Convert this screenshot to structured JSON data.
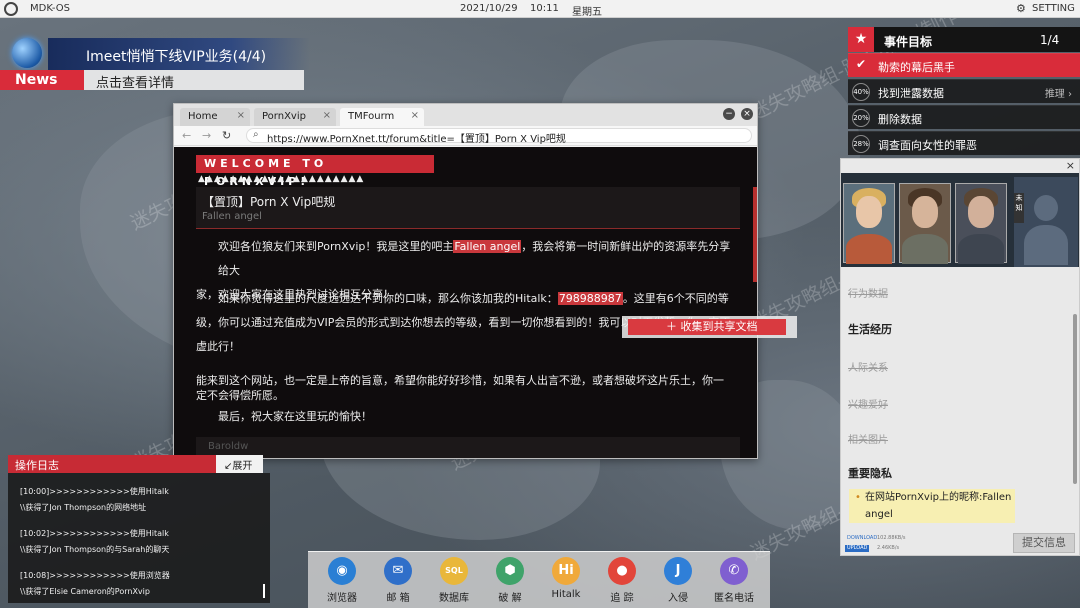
{
  "topbar": {
    "os_name": "MDK-OS",
    "date": "2021/10/29",
    "time": "10:11",
    "weekday": "星期五",
    "setting_label": "SETTING"
  },
  "news": {
    "headline": "Imeet悄悄下线VIP业务(4/4)",
    "tag": "News",
    "link_text": "点击查看详情"
  },
  "browser": {
    "tabs": [
      {
        "label": "Home",
        "active": false
      },
      {
        "label": "PornXvip",
        "active": false
      },
      {
        "label": "TMFourm",
        "active": true
      }
    ],
    "minimize_glyph": "−",
    "close_glyph": "×",
    "url": "https://www.PornXnet.tt/forum&title=【置顶】Porn X Vip吧规",
    "page": {
      "banner": "WELCOME TO PORNXVIP!",
      "decoration": "▲▲▲▲▲▲▲▲▲▲▲▲▲▲▲▲▲▲▲▲▲",
      "post_title": "【置顶】Porn X Vip吧规",
      "post_author": "Fallen angel",
      "p1_a": "欢迎各位狼友们来到PornXvip！我是这里的吧主",
      "p1_hl": "Fallen angel",
      "p1_b": "，我会将第一时间新鲜出炉的资源率先分享给大",
      "p1_c": "家，欢迎大家在这里热烈讨论相互分享！",
      "p2_a": "如果你觉得这里的尺度远远达不到你的口味，那么你该加我的Hitalk：",
      "p2_hl": "798988987",
      "p2_b": "。这里有6个不同的等",
      "p2_c": "级，你可以通过充值成为VIP会员的形式到达你想去的等级，看到一切你想看到的！我可以对天发誓，你一定不",
      "p2_d": "虚此行！",
      "p3_a": "能来到这个网站，也一定是上帝的旨意，希望你能好好珍惜，如果有人出言不逊，或者想破坏这片乐土，你一",
      "p3_b": "定不会得偿所愿。",
      "p4": "最后，祝大家在这里玩的愉快！",
      "footer_user": "Baroldw"
    }
  },
  "context_menu": {
    "item": "＋ 收集到共享文档"
  },
  "events": {
    "title": "事件目标",
    "count": "1/4",
    "items": [
      {
        "status": "done",
        "label": "勒索的幕后黑手",
        "extra": ""
      },
      {
        "status": "40%",
        "label": "找到泄露数据",
        "extra": "推理 ›"
      },
      {
        "status": "20%",
        "label": "删除数据",
        "extra": ""
      },
      {
        "status": "28%",
        "label": "调查面向女性的罪恶",
        "extra": ""
      }
    ]
  },
  "profile": {
    "close": "×",
    "unknown_tag": "未知",
    "section_prev": "行为数据",
    "section_life": "生活经历",
    "item_relations": "人际关系",
    "item_hobbies": "兴趣爱好",
    "item_photos": "相关图片",
    "section_secrets": "重要隐私",
    "secret_text": "在网站PornXvip上的昵称:Fallen angel",
    "download_label": "DOWNLOAD",
    "download_value": "102.88KB/s",
    "upload_label": "UPLOAD",
    "upload_value": "2.46KB/s",
    "submit": "提交信息"
  },
  "log": {
    "title": "操作日志",
    "expand": "↙展开",
    "lines": [
      "[10:00]>>>>>>>>>>>>使用Hitalk",
      "\\\\获得了Jon Thompson的网络地址",
      "[10:02]>>>>>>>>>>>>使用Hitalk",
      "\\\\获得了Jon Thompson的与Sarah的聊天",
      "[10:08]>>>>>>>>>>>>使用浏览器",
      "\\\\获得了Elsie Cameron的PornXvip"
    ]
  },
  "dock": {
    "items": [
      {
        "label": "浏览器",
        "icon": "globe-icon",
        "color": "#2a7fd4",
        "glyph": "◉"
      },
      {
        "label": "邮 箱",
        "icon": "mail-icon",
        "color": "#2f6fc9",
        "glyph": "✉"
      },
      {
        "label": "数据库",
        "icon": "database-icon",
        "color": "#e9b73a",
        "glyph": "SQL"
      },
      {
        "label": "破 解",
        "icon": "shield-icon",
        "color": "#3fa36a",
        "glyph": "⬢"
      },
      {
        "label": "Hitalk",
        "icon": "hitalk-icon",
        "color": "#f0a93a",
        "glyph": "Hi"
      },
      {
        "label": "追 踪",
        "icon": "location-icon",
        "color": "#e2453a",
        "glyph": "●"
      },
      {
        "label": "入侵",
        "icon": "hook-icon",
        "color": "#2f7fd8",
        "glyph": "J"
      },
      {
        "label": "匿名电话",
        "icon": "phone-icon",
        "color": "#7f5fd0",
        "glyph": "✆"
      }
    ]
  },
  "watermark": "迷失攻略组-路人a原创制作"
}
